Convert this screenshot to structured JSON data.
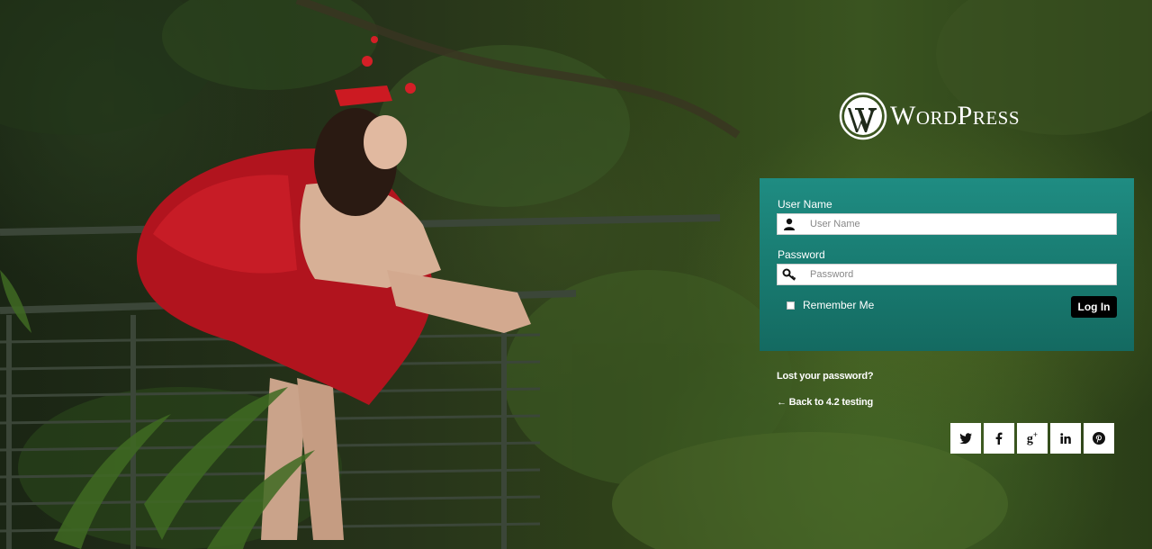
{
  "brand": {
    "name": "WordPress",
    "logo_icon": "wordpress-logo-icon"
  },
  "login_form": {
    "username_label": "User Name",
    "username_placeholder": "User Name",
    "username_value": "",
    "password_label": "Password",
    "password_placeholder": "Password",
    "password_value": "",
    "remember_label": "Remember Me",
    "remember_checked": false,
    "submit_label": "Log In"
  },
  "links": {
    "lost_password": "Lost your password?",
    "back_to_site": "← Back to 4.2 testing"
  },
  "social": [
    {
      "name": "twitter",
      "icon": "twitter-icon"
    },
    {
      "name": "facebook",
      "icon": "facebook-icon"
    },
    {
      "name": "google-plus",
      "icon": "google-plus-icon"
    },
    {
      "name": "linkedin",
      "icon": "linkedin-icon"
    },
    {
      "name": "pinterest",
      "icon": "pinterest-icon"
    }
  ],
  "colors": {
    "panel": "#187a70",
    "button": "#000000",
    "text": "#ffffff"
  }
}
